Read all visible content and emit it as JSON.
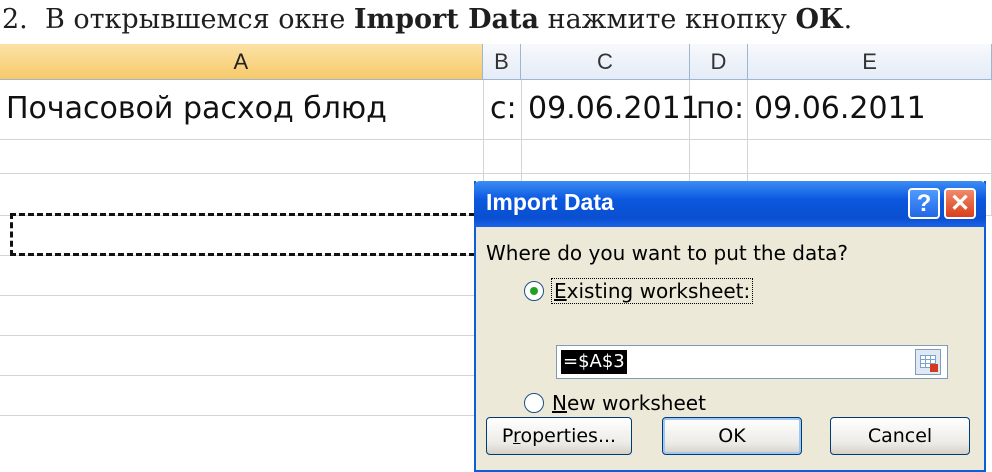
{
  "instruction": {
    "number": "2.",
    "text_before": "В открывшемся окне ",
    "dialog_name": "Import Data",
    "text_middle": " нажмите кнопку ",
    "button_name": "ОК",
    "text_after": "."
  },
  "sheet": {
    "columns": [
      "A",
      "B",
      "C",
      "D",
      "E"
    ],
    "selected_column": "A",
    "row1": {
      "title": "Почасовой расход блюд",
      "from_label": "с:",
      "from_date": "09.06.2011",
      "to_label": "по:",
      "to_date": "09.06.2011"
    }
  },
  "dialog": {
    "title": "Import Data",
    "help_label": "?",
    "close_label": "✕",
    "prompt": "Where do you want to put the data?",
    "existing": {
      "accel": "E",
      "rest": "xisting worksheet:",
      "checked": true
    },
    "reference_value": "=$A$3",
    "new_sheet": {
      "accel": "N",
      "rest": "ew worksheet",
      "checked": false
    },
    "buttons": {
      "properties_prefix": "P",
      "properties_accel": "r",
      "properties_rest": "operties...",
      "ok": "OK",
      "cancel": "Cancel"
    }
  },
  "colors": {
    "selection_border": "#111111",
    "title_bar": "#0b58e0",
    "dialog_bg": "#ece9d8"
  },
  "icons": [
    "help-icon",
    "close-icon",
    "collapse-dialog-icon"
  ]
}
